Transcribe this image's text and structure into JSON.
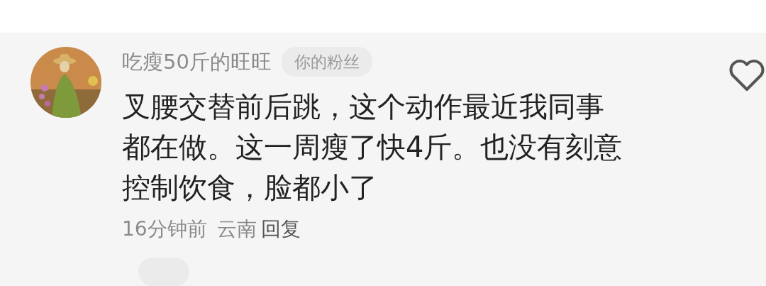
{
  "comment": {
    "author": "吃瘦50斤的旺旺",
    "badge": "你的粉丝",
    "text": "叉腰交替前后跳，这个动作最近我同事都在做。这一周瘦了快4斤。也没有刻意控制饮食，脸都小了",
    "time": "16分钟前",
    "location": "云南",
    "reply": "回复",
    "liked": false
  }
}
